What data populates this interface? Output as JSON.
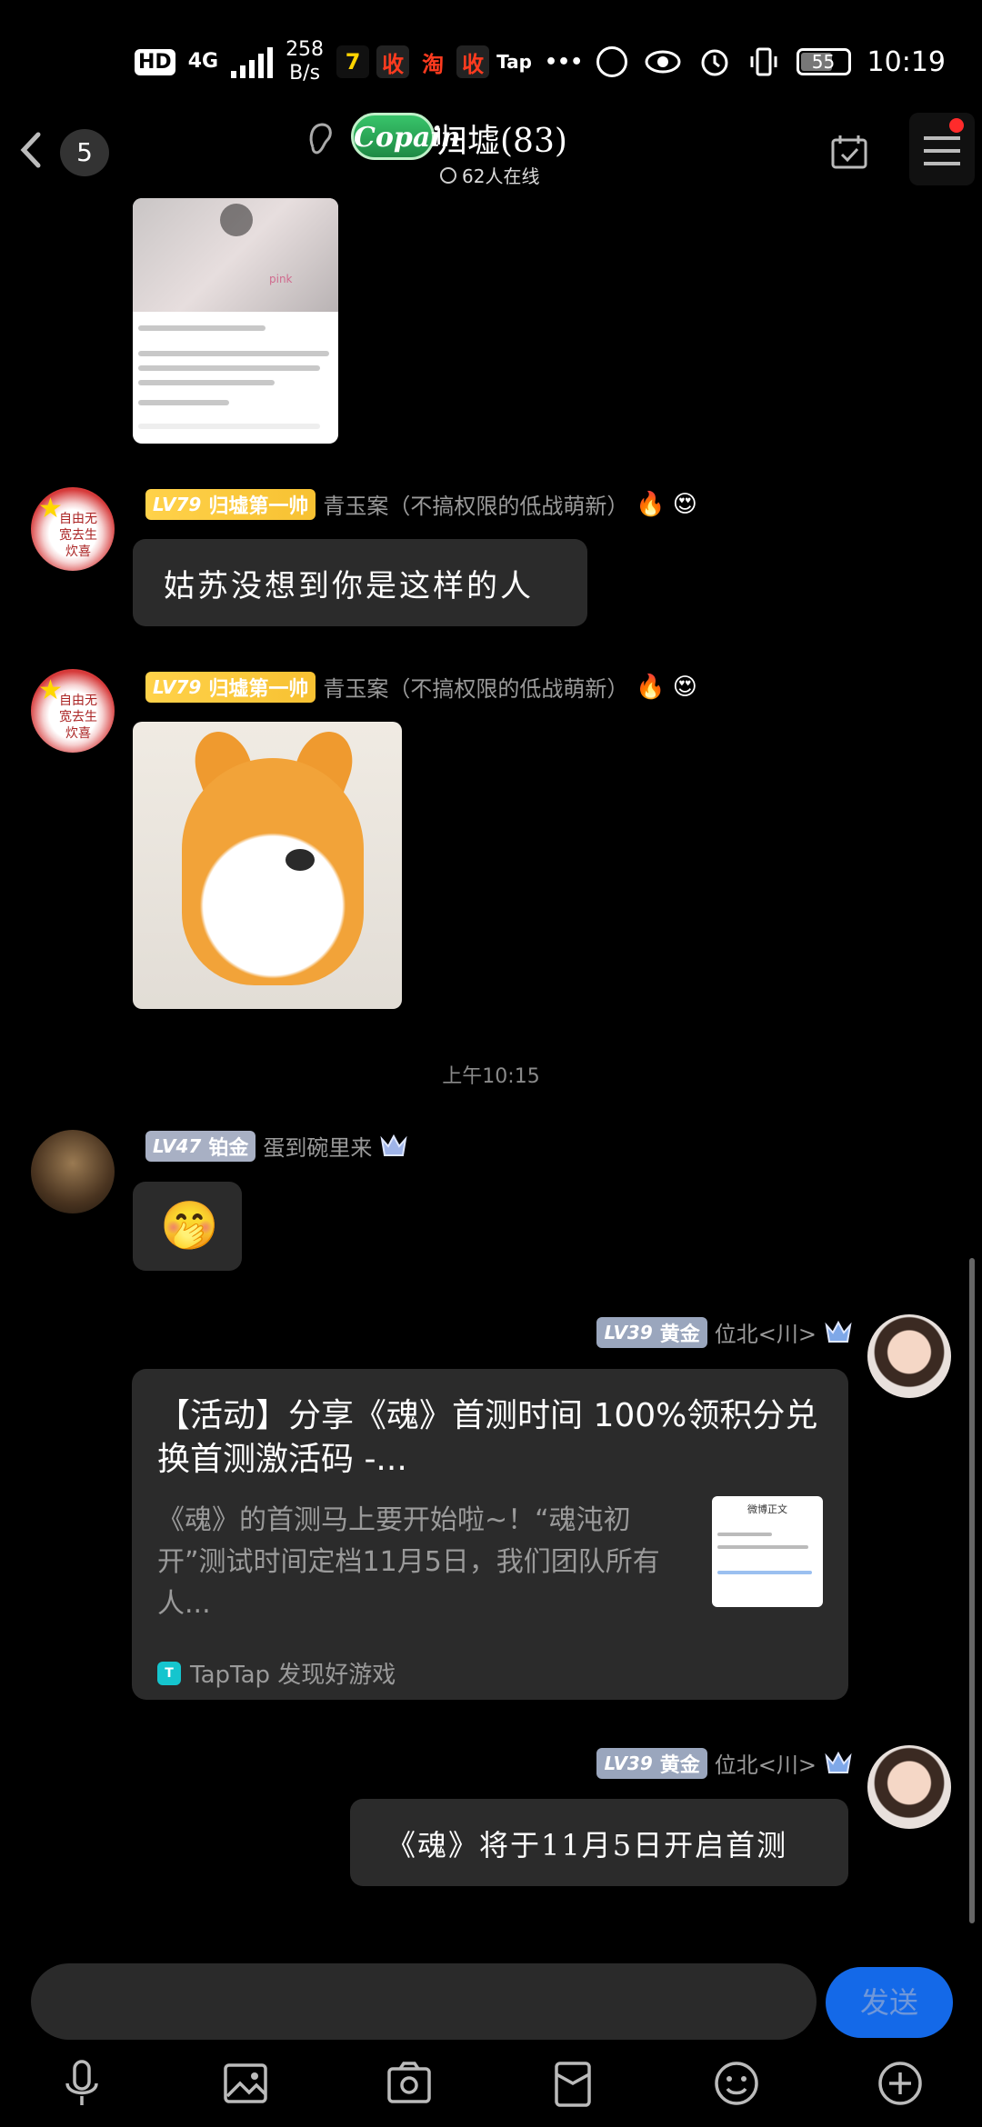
{
  "status_bar": {
    "hd": "HD",
    "network": "4G",
    "speed_value": "258",
    "speed_unit": "B/s",
    "apps": [
      {
        "label": "7",
        "bg": "#111111",
        "fg": "#ffd400"
      },
      {
        "label": "收",
        "bg": "#222222",
        "fg": "#ff3b1f"
      },
      {
        "label": "淘",
        "bg": "#000000",
        "fg": "#ff3b1f"
      },
      {
        "label": "收",
        "bg": "#222222",
        "fg": "#ff3b1f"
      },
      {
        "label": "Tap",
        "bg": "#000000",
        "fg": "#ffffff"
      }
    ],
    "more": "•••",
    "battery": "55",
    "time": "10:19"
  },
  "header": {
    "unread_count": "5",
    "group_logo": "Copain",
    "group_title": "归墟(83)",
    "online": "62人在线",
    "menu_dot_color": "#ff2b2b"
  },
  "messages": [
    {
      "user": {
        "level": "LV79",
        "title": "归墟第一帅",
        "nick": "青玉案（不搞权限的低战萌新）",
        "badges": [
          "🔥",
          "😍"
        ]
      },
      "text": "姑苏没想到你是这样的人"
    },
    {
      "user": {
        "level": "LV79",
        "title": "归墟第一帅",
        "nick": "青玉案（不搞权限的低战萌新）",
        "badges": [
          "🔥",
          "😍"
        ]
      },
      "sticker": "corgi"
    },
    {
      "timestamp": "上午10:15"
    },
    {
      "user": {
        "level": "LV47",
        "title": "铂金",
        "nick": "蛋到碗里来"
      },
      "emoji": "🤭"
    },
    {
      "user": {
        "level": "LV39",
        "title": "黄金",
        "nick": "位北<川>"
      },
      "card": {
        "title": "【活动】分享《魂》首测时间 100%领积分兑换首测激活码 -...",
        "desc": "《魂》的首测马上要开始啦~！“魂沌初开”测试时间定档11月5日，我们团队所有人...",
        "source": "TapTap 发现好游戏"
      }
    },
    {
      "user": {
        "level": "LV39",
        "title": "黄金",
        "nick": "位北<川>"
      },
      "text": "《魂》将于11月5日开启首测"
    }
  ],
  "input": {
    "placeholder": "",
    "send": "发送"
  },
  "thumbnail_text": "pink",
  "card_image_header": "微博正文",
  "avatar_text": "自由无宽去生炊喜"
}
